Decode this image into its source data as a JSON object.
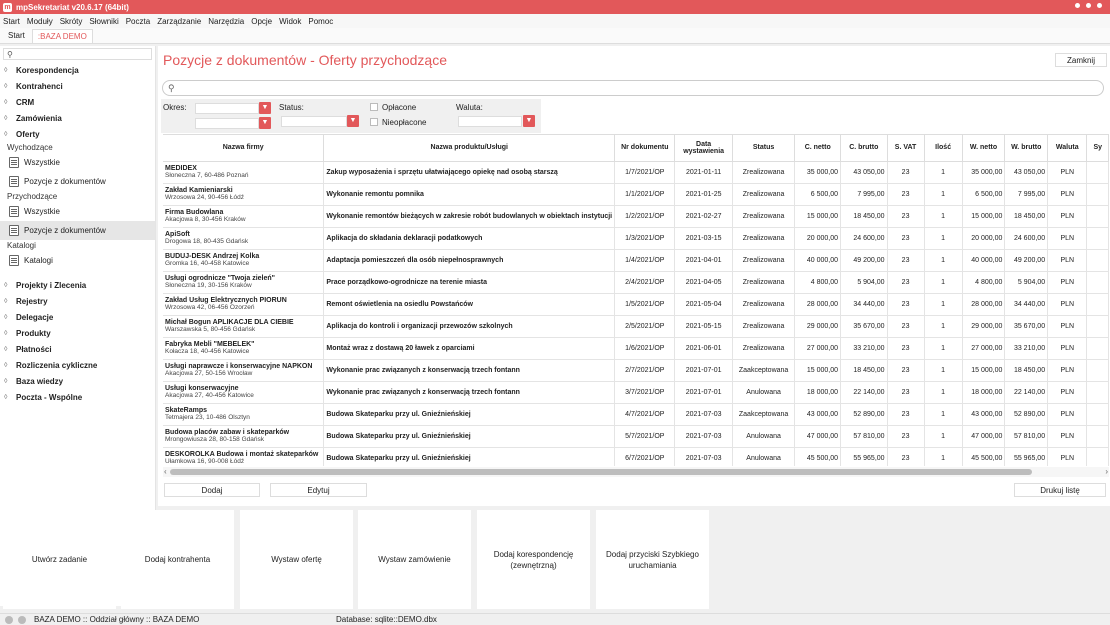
{
  "app": {
    "title": "mpSekretariat v20.6.17 (64bit)"
  },
  "menu": [
    "Start",
    "Moduły",
    "Skróty",
    "Słowniki",
    "Poczta",
    "Zarządzanie",
    "Narzędzia",
    "Opcje",
    "Widok",
    "Pomoc"
  ],
  "tabs": [
    {
      "label": "Start",
      "active": false
    },
    {
      "label": ":BAZA DEMO",
      "active": true
    }
  ],
  "sidebar": {
    "sections_top": [
      "Korespondencja",
      "Kontrahenci",
      "CRM",
      "Zamówienia",
      "Oferty"
    ],
    "oferty": {
      "wychodzace_label": "Wychodzące",
      "wychodzace_items": [
        "Wszystkie",
        "Pozycje z dokumentów"
      ],
      "przychodzace_label": "Przychodzące",
      "przychodzace_items": [
        "Wszystkie",
        "Pozycje z dokumentów"
      ],
      "katalogi_label": "Katalogi",
      "katalogi_items": [
        "Katalogi"
      ]
    },
    "sections_bottom": [
      "Projekty i Zlecenia",
      "Rejestry",
      "Delegacje",
      "Produkty",
      "Płatności",
      "Rozliczenia cykliczne",
      "Baza wiedzy",
      "Poczta - Wspólne"
    ]
  },
  "main": {
    "title": "Pozycje z dokumentów - Oferty przychodzące",
    "close_label": "Zamknij",
    "filters": {
      "okres_label": "Okres:",
      "status_label": "Status:",
      "oplacone_label": "Opłacone",
      "nieoplacone_label": "Nieopłacone",
      "waluta_label": "Waluta:"
    },
    "columns": [
      "Nazwa firmy",
      "Nazwa produktu/Usługi",
      "Nr dokumentu",
      "Data wystawienia",
      "Status",
      "C. netto",
      "C. brutto",
      "S. VAT",
      "Ilość",
      "W. netto",
      "W. brutto",
      "Waluta",
      "Sy"
    ],
    "rows": [
      {
        "name": "MEDIDEX",
        "addr": "Słoneczna 7, 60-486 Poznań",
        "product": "Zakup wyposażenia i sprzętu ułatwiającego opiekę nad osobą starszą",
        "nr": "1/7/2021/OP",
        "date": "2021-01-11",
        "status": "Zrealizowana",
        "cnet": "35 000,00",
        "cbr": "43 050,00",
        "vat": "23",
        "qty": "1",
        "wnet": "35 000,00",
        "wbr": "43 050,00",
        "cur": "PLN"
      },
      {
        "name": "Zakład Kamieniarski",
        "addr": "Wrzosowa 24, 90-456 Łódź",
        "product": "Wykonanie remontu pomnika",
        "nr": "1/1/2021/OP",
        "date": "2021-01-25",
        "status": "Zrealizowana",
        "cnet": "6 500,00",
        "cbr": "7 995,00",
        "vat": "23",
        "qty": "1",
        "wnet": "6 500,00",
        "wbr": "7 995,00",
        "cur": "PLN"
      },
      {
        "name": "Firma Budowlana",
        "addr": "Akacjowa 8, 30-456 Kraków",
        "product": "Wykonanie remontów bieżących w zakresie robót budowlanych w obiektach instytucji",
        "nr": "1/2/2021/OP",
        "date": "2021-02-27",
        "status": "Zrealizowana",
        "cnet": "15 000,00",
        "cbr": "18 450,00",
        "vat": "23",
        "qty": "1",
        "wnet": "15 000,00",
        "wbr": "18 450,00",
        "cur": "PLN"
      },
      {
        "name": "ApiSoft",
        "addr": "Drogowa 18, 80-435 Gdańsk",
        "product": "Aplikacja do składania deklaracji podatkowych",
        "nr": "1/3/2021/OP",
        "date": "2021-03-15",
        "status": "Zrealizowana",
        "cnet": "20 000,00",
        "cbr": "24 600,00",
        "vat": "23",
        "qty": "1",
        "wnet": "20 000,00",
        "wbr": "24 600,00",
        "cur": "PLN"
      },
      {
        "name": "BUDUJ-DESK Andrzej Kolka",
        "addr": "Gromka 16, 40-458 Katowice",
        "product": "Adaptacja pomieszczeń dla osób niepełnosprawnych",
        "nr": "1/4/2021/OP",
        "date": "2021-04-01",
        "status": "Zrealizowana",
        "cnet": "40 000,00",
        "cbr": "49 200,00",
        "vat": "23",
        "qty": "1",
        "wnet": "40 000,00",
        "wbr": "49 200,00",
        "cur": "PLN"
      },
      {
        "name": "Usługi ogrodnicze \"Twoja zieleń\"",
        "addr": "Słoneczna 19, 30-156 Kraków",
        "product": "Prace porządkowo-ogrodnicze na terenie miasta",
        "nr": "2/4/2021/OP",
        "date": "2021-04-05",
        "status": "Zrealizowana",
        "cnet": "4 800,00",
        "cbr": "5 904,00",
        "vat": "23",
        "qty": "1",
        "wnet": "4 800,00",
        "wbr": "5 904,00",
        "cur": "PLN"
      },
      {
        "name": "Zakład Usług Elektrycznych PIORUN",
        "addr": "Wrzosowa 42, 06-456 Ozorzeń",
        "product": "Remont oświetlenia na osiedlu Powstańców",
        "nr": "1/5/2021/OP",
        "date": "2021-05-04",
        "status": "Zrealizowana",
        "cnet": "28 000,00",
        "cbr": "34 440,00",
        "vat": "23",
        "qty": "1",
        "wnet": "28 000,00",
        "wbr": "34 440,00",
        "cur": "PLN"
      },
      {
        "name": "Michał Bogun APLIKACJE DLA CIEBIE",
        "addr": "Warszawska 5, 80-456 Gdańsk",
        "product": "Aplikacja do kontroli i organizacji przewozów szkolnych",
        "nr": "2/5/2021/OP",
        "date": "2021-05-15",
        "status": "Zrealizowana",
        "cnet": "29 000,00",
        "cbr": "35 670,00",
        "vat": "23",
        "qty": "1",
        "wnet": "29 000,00",
        "wbr": "35 670,00",
        "cur": "PLN"
      },
      {
        "name": "Fabryka Mebli \"MEBELEK\"",
        "addr": "Kołacza 18, 40-456 Katowice",
        "product": "Montaż wraz z dostawą 20 ławek z oparciami",
        "nr": "1/6/2021/OP",
        "date": "2021-06-01",
        "status": "Zrealizowana",
        "cnet": "27 000,00",
        "cbr": "33 210,00",
        "vat": "23",
        "qty": "1",
        "wnet": "27 000,00",
        "wbr": "33 210,00",
        "cur": "PLN"
      },
      {
        "name": "Usługi naprawcze i konserwacyjne NAPKON",
        "addr": "Akacjowa 27, 50-156 Wrocław",
        "product": "Wykonanie prac związanych z konserwacją trzech fontann",
        "nr": "2/7/2021/OP",
        "date": "2021-07-01",
        "status": "Zaakceptowana",
        "cnet": "15 000,00",
        "cbr": "18 450,00",
        "vat": "23",
        "qty": "1",
        "wnet": "15 000,00",
        "wbr": "18 450,00",
        "cur": "PLN"
      },
      {
        "name": "Usługi konserwacyjne",
        "addr": "Akacjowa 27, 40-456 Katowice",
        "product": "Wykonanie prac związanych z konserwacją trzech fontann",
        "nr": "3/7/2021/OP",
        "date": "2021-07-01",
        "status": "Anulowana",
        "cnet": "18 000,00",
        "cbr": "22 140,00",
        "vat": "23",
        "qty": "1",
        "wnet": "18 000,00",
        "wbr": "22 140,00",
        "cur": "PLN"
      },
      {
        "name": "SkateRamps",
        "addr": "Tetmajera 23, 10-486 Olsztyn",
        "product": "Budowa Skateparku przy ul. Gnieźnieńskiej",
        "nr": "4/7/2021/OP",
        "date": "2021-07-03",
        "status": "Zaakceptowana",
        "cnet": "43 000,00",
        "cbr": "52 890,00",
        "vat": "23",
        "qty": "1",
        "wnet": "43 000,00",
        "wbr": "52 890,00",
        "cur": "PLN"
      },
      {
        "name": "Budowa placów zabaw i skateparków",
        "addr": "Mrongowiusza 28, 80-158 Gdańsk",
        "product": "Budowa Skateparku przy ul. Gnieźnieńskiej",
        "nr": "5/7/2021/OP",
        "date": "2021-07-03",
        "status": "Anulowana",
        "cnet": "47 000,00",
        "cbr": "57 810,00",
        "vat": "23",
        "qty": "1",
        "wnet": "47 000,00",
        "wbr": "57 810,00",
        "cur": "PLN"
      },
      {
        "name": "DESKOROLKA Budowa i montaż skateparków",
        "addr": "Ułamkowa 16, 90-008 Łódź",
        "product": "Budowa Skateparku przy ul. Gnieźnieńskiej",
        "nr": "6/7/2021/OP",
        "date": "2021-07-03",
        "status": "Anulowana",
        "cnet": "45 500,00",
        "cbr": "55 965,00",
        "vat": "23",
        "qty": "1",
        "wnet": "45 500,00",
        "wbr": "55 965,00",
        "cur": "PLN"
      }
    ],
    "buttons": {
      "add": "Dodaj",
      "edit": "Edytuj",
      "print": "Drukuj listę"
    }
  },
  "tiles": [
    "Utwórz zadanie",
    "Dodaj kontrahenta",
    "Wystaw ofertę",
    "Wystaw zamówienie",
    "Dodaj korespondencję (zewnętrzną)",
    "Dodaj przyciski Szybkiego uruchamiania"
  ],
  "statusbar": {
    "left": "BAZA DEMO :: Oddział główny :: BAZA DEMO",
    "db": "Database: sqlite::DEMO.dbx"
  },
  "colors": {
    "accent": "#e2585a"
  }
}
